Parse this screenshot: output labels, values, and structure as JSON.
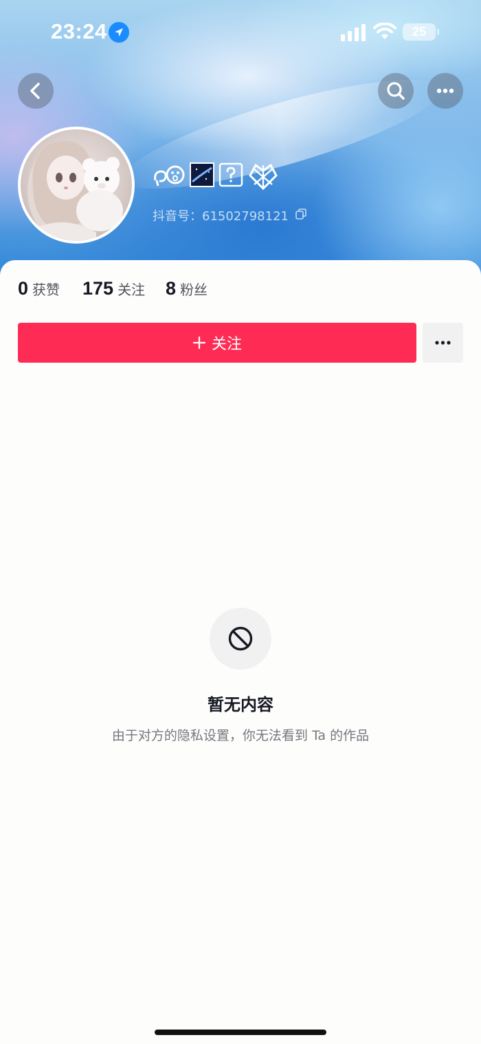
{
  "status_bar": {
    "time": "23:24",
    "battery": "25",
    "icons": [
      "location-arrow-icon",
      "signal-icon",
      "wifi-icon",
      "battery-icon"
    ]
  },
  "nav": {
    "back_icon": "chevron-left-icon",
    "search_icon": "search-icon",
    "more_icon": "ellipsis-icon"
  },
  "profile": {
    "name_icons": [
      "emoticon-glyph",
      "starry-image-emoji",
      "question-box-emoji",
      "pixel-heart-glyph"
    ],
    "douyin_id": "抖音号：61502798121"
  },
  "stats": [
    {
      "value": "0",
      "label": "获赞"
    },
    {
      "value": "175",
      "label": "关注"
    },
    {
      "value": "8",
      "label": "粉丝"
    }
  ],
  "actions": {
    "follow_label": "关注",
    "follow_icon": "plus-icon",
    "options_icon": "ellipsis-icon"
  },
  "empty_state": {
    "icon": "prohibited-icon",
    "title": "暂无内容",
    "description": "由于对方的隐私设置，你无法看到 Ta 的作品"
  },
  "colors": {
    "accent": "#fe2c55",
    "text_primary": "#161823",
    "text_secondary": "#75767d",
    "card_bg": "#fdfdfc"
  }
}
